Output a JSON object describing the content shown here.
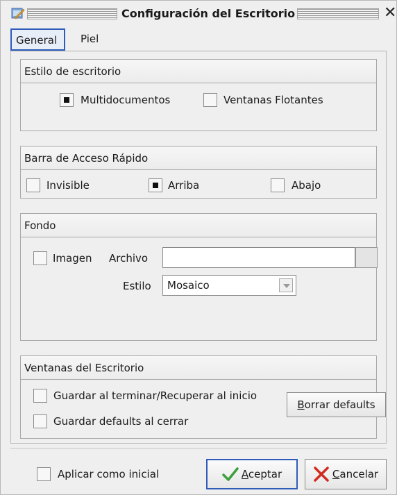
{
  "window": {
    "title": "Configuración del Escritorio",
    "close_glyph": "✕"
  },
  "tabs": [
    {
      "label": "General",
      "selected": true
    },
    {
      "label": "Piel",
      "selected": false
    }
  ],
  "estilo": {
    "header": "Estilo de escritorio",
    "multidocumentos": {
      "label": "Multidocumentos",
      "checked": true
    },
    "ventanas_flotantes": {
      "label": "Ventanas Flotantes",
      "checked": false
    }
  },
  "barra": {
    "header": "Barra de Acceso Rápido",
    "invisible": {
      "label": "Invisible",
      "checked": false
    },
    "arriba": {
      "label": "Arriba",
      "checked": true
    },
    "abajo": {
      "label": "Abajo",
      "checked": false
    }
  },
  "fondo": {
    "header": "Fondo",
    "imagen": {
      "label": "Imagen",
      "checked": false
    },
    "archivo_label": "Archivo",
    "archivo_value": "",
    "estilo_label": "Estilo",
    "estilo_value": "Mosaico"
  },
  "ventanas": {
    "header": "Ventanas del Escritorio",
    "guardar_terminar": {
      "label": "Guardar al terminar/Recuperar al inicio",
      "checked": false
    },
    "guardar_defaults": {
      "label": "Guardar defaults al cerrar",
      "checked": false
    },
    "borrar_first": "B",
    "borrar_rest": "orrar defaults"
  },
  "footer": {
    "aplicar": {
      "label": "Aplicar como inicial",
      "checked": false
    },
    "aceptar_first": "A",
    "aceptar_rest": "ceptar",
    "cancelar_first": "C",
    "cancelar_rest": "ancelar"
  },
  "colors": {
    "accent": "#2e5cb8",
    "check_icon": "#3ca03c",
    "cross_icon": "#d22a1e"
  },
  "icons": [
    "app-icon",
    "close-icon",
    "check-icon",
    "cross-icon",
    "combo-arrow-icon"
  ]
}
